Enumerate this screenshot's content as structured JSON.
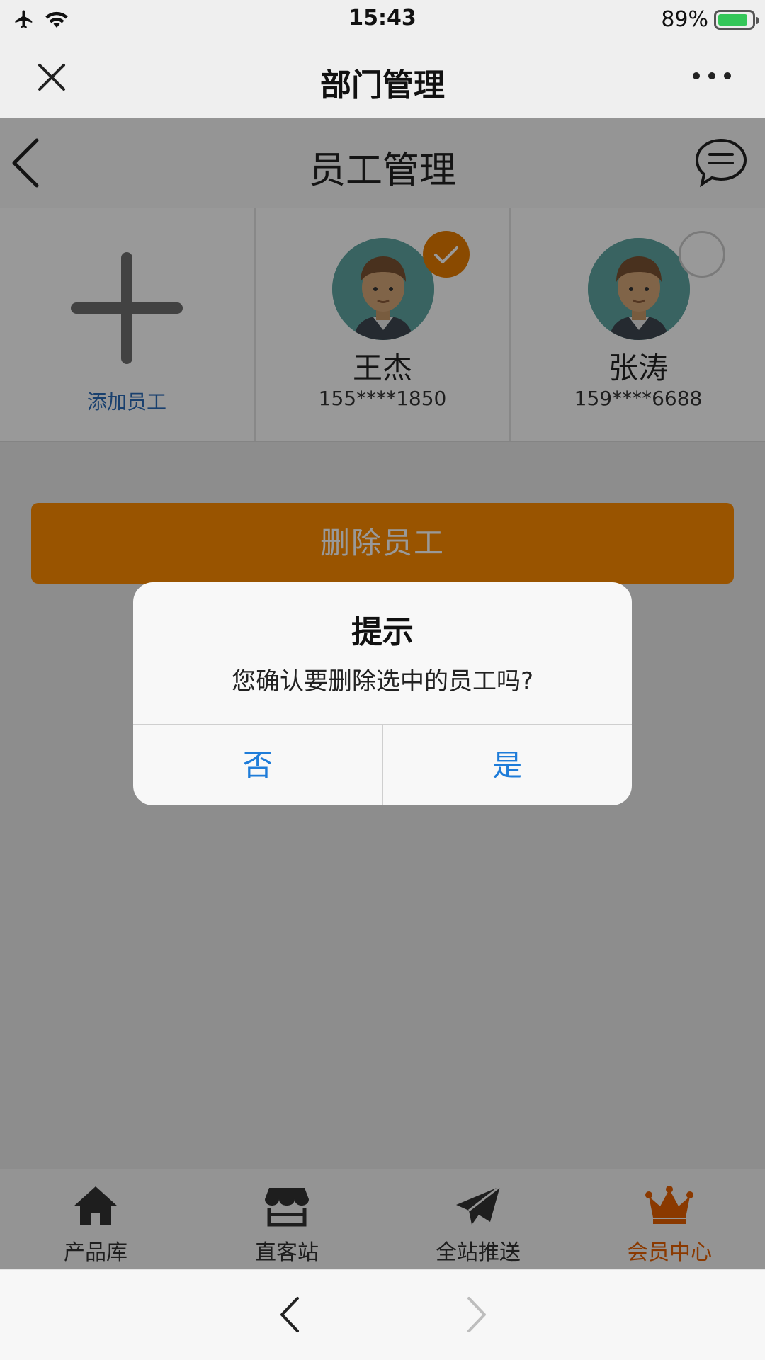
{
  "status_bar": {
    "time": "15:43",
    "battery": "89%",
    "battery_level": 0.89
  },
  "mini_nav": {
    "title": "部门管理"
  },
  "page_header": {
    "title": "员工管理"
  },
  "staff": {
    "add_label": "添加员工",
    "members": [
      {
        "name": "王杰",
        "phone": "155****1850",
        "selected": true
      },
      {
        "name": "张涛",
        "phone": "159****6688",
        "selected": false
      }
    ]
  },
  "delete_button": {
    "label": "删除员工"
  },
  "dialog": {
    "title": "提示",
    "message": "您确认要删除选中的员工吗?",
    "cancel_label": "否",
    "confirm_label": "是"
  },
  "tabs": [
    {
      "label": "产品库",
      "icon": "home-icon",
      "active": false
    },
    {
      "label": "直客站",
      "icon": "store-icon",
      "active": false
    },
    {
      "label": "全站推送",
      "icon": "paper-plane-icon",
      "active": false
    },
    {
      "label": "会员中心",
      "icon": "crown-icon",
      "active": true
    }
  ],
  "colors": {
    "accent": "#ff8c00",
    "link": "#1e7cd9",
    "active_tab": "#e65f00",
    "add_label": "#2b6cb8"
  }
}
